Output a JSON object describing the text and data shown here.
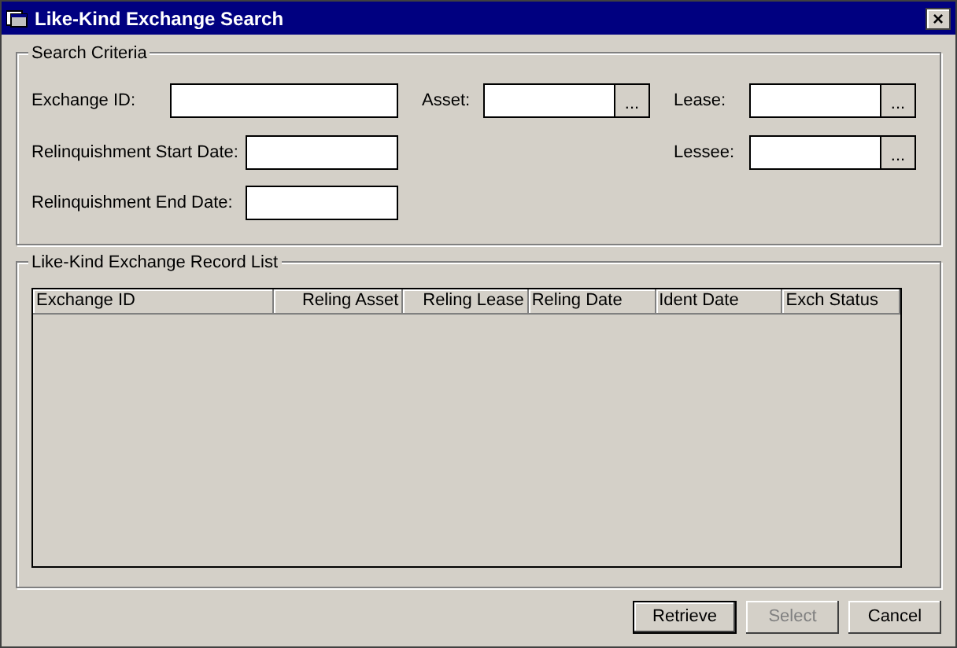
{
  "window": {
    "title": "Like-Kind Exchange Search",
    "close": "×"
  },
  "search_criteria": {
    "title": "Search Criteria",
    "exchange_id": {
      "label": "Exchange ID:"
    },
    "asset": {
      "label": "Asset:",
      "browse": "..."
    },
    "lease": {
      "label": "Lease:",
      "browse": "..."
    },
    "relinquishment_start_date": {
      "label": "Relinquishment Start Date:"
    },
    "lessee": {
      "label": "Lessee:",
      "browse": "..."
    },
    "relinquishment_end_date": {
      "label": "Relinquishment End Date:"
    }
  },
  "record_list": {
    "title": "Like-Kind Exchange Record List",
    "columns": [
      {
        "label": "Exchange ID",
        "kind": "text"
      },
      {
        "label": "Reling Asset",
        "kind": "numeric"
      },
      {
        "label": "Reling Lease",
        "kind": "numeric"
      },
      {
        "label": "Reling Date",
        "kind": "text"
      },
      {
        "label": "Ident Date",
        "kind": "text"
      },
      {
        "label": "Exch Status",
        "kind": "text"
      }
    ]
  },
  "buttons": [
    {
      "label": "Retrieve",
      "default": true,
      "disabled": false
    },
    {
      "label": "Select",
      "default": false,
      "disabled": true
    },
    {
      "label": "Cancel",
      "default": false,
      "disabled": false
    }
  ]
}
